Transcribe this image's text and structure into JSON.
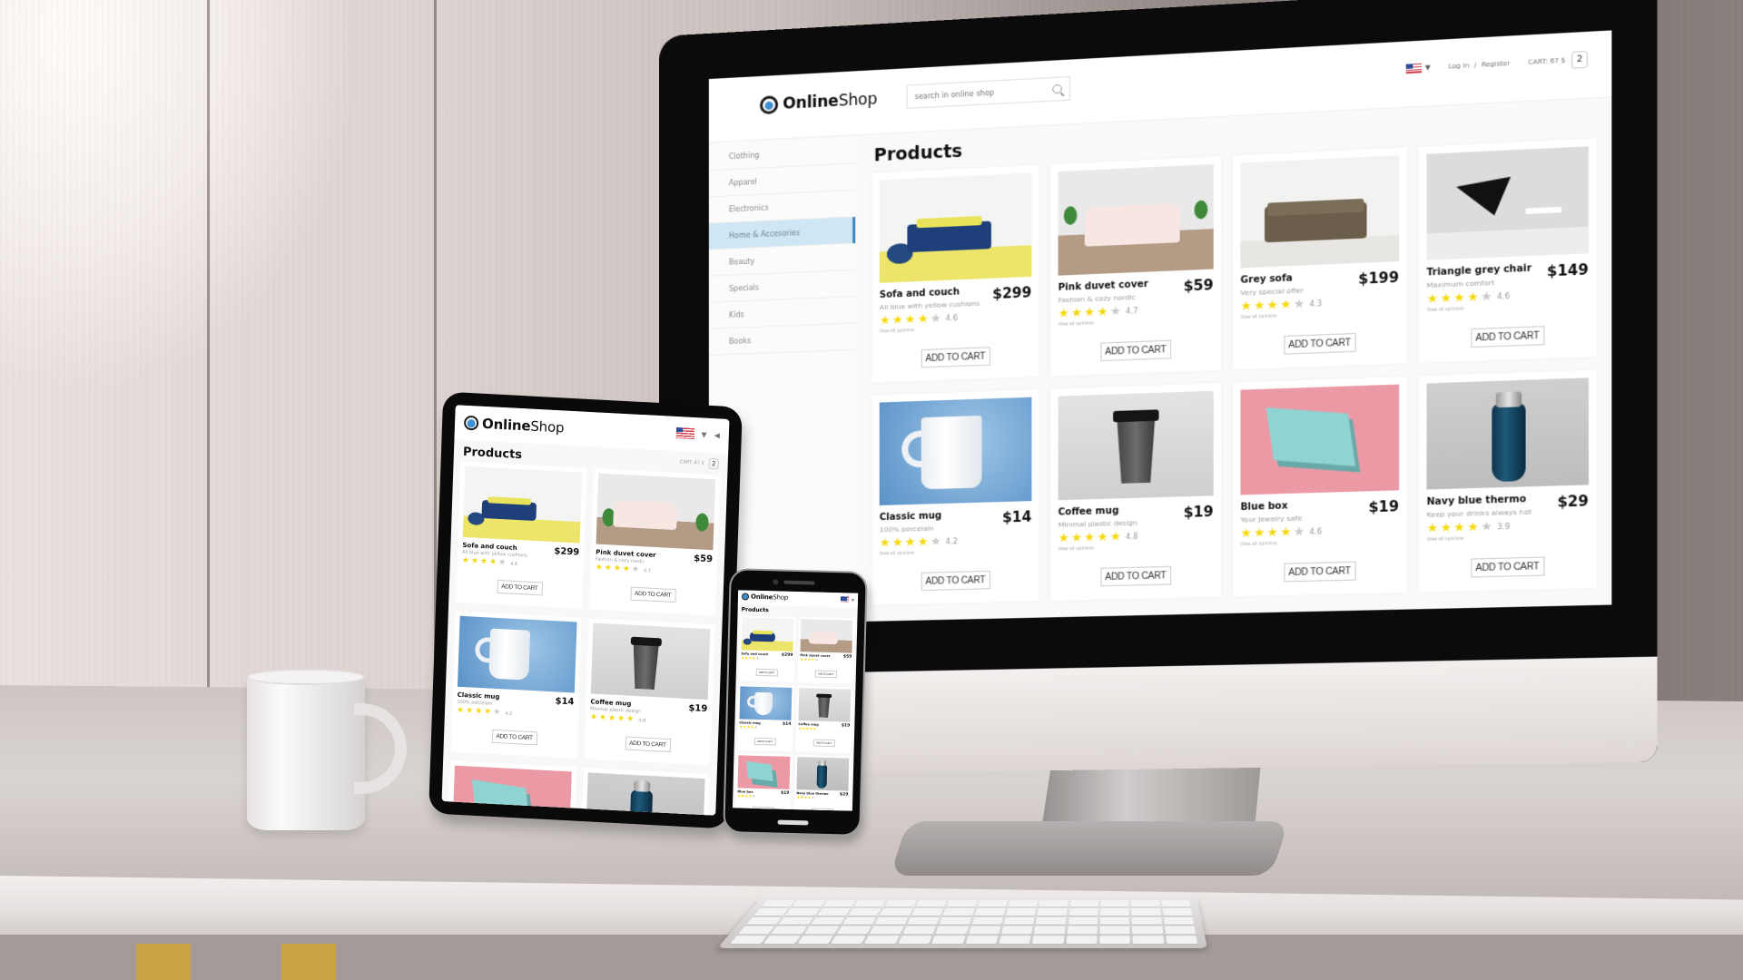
{
  "scene": {
    "description": "Responsive e-commerce mockup on desktop monitor, tablet and phone on a desk"
  },
  "brand": {
    "name_bold": "Online",
    "name_light": "Shop",
    "accent_color": "#3f87c2",
    "star_color": "#f5d90b"
  },
  "header": {
    "search_placeholder": "search in online shop",
    "language": "US",
    "login_label": "Log in",
    "separator": "/",
    "register_label": "Register",
    "cart_label": "CART: 67 $",
    "cart_count": "2"
  },
  "sidebar": {
    "items": [
      {
        "label": "Clothing",
        "active": false
      },
      {
        "label": "Apparel",
        "active": false
      },
      {
        "label": "Electronics",
        "active": false
      },
      {
        "label": "Home & Accesories",
        "active": true
      },
      {
        "label": "Beauty",
        "active": false
      },
      {
        "label": "Specials",
        "active": false
      },
      {
        "label": "Kids",
        "active": false
      },
      {
        "label": "Books",
        "active": false
      }
    ]
  },
  "main": {
    "title": "Products",
    "add_to_cart_label": "ADD TO CART",
    "view_opinions_label": "View all opinions",
    "products": [
      {
        "name": "Sofa and couch",
        "subtitle": "All blue with yellow cushions",
        "price": "$299",
        "rating": 4.6,
        "rating_text": "4.6",
        "stars_full": 4,
        "image": "sofa"
      },
      {
        "name": "Pink duvet cover",
        "subtitle": "Fashion & cozy nordic",
        "price": "$59",
        "rating": 4.7,
        "rating_text": "4.7",
        "stars_full": 4,
        "image": "bed"
      },
      {
        "name": "Grey sofa",
        "subtitle": "Very special offer",
        "price": "$199",
        "rating": 4.3,
        "rating_text": "4.3",
        "stars_full": 4,
        "image": "grey"
      },
      {
        "name": "Triangle grey chair",
        "subtitle": "Maximum comfort",
        "price": "$149",
        "rating": 4.6,
        "rating_text": "4.6",
        "stars_full": 4,
        "image": "chair"
      },
      {
        "name": "Classic mug",
        "subtitle": "100% porcelain",
        "price": "$14",
        "rating": 4.2,
        "rating_text": "4.2",
        "stars_full": 4,
        "image": "mug"
      },
      {
        "name": "Coffee mug",
        "subtitle": "Minimal plastic design",
        "price": "$19",
        "rating": 4.8,
        "rating_text": "4.8",
        "stars_full": 5,
        "image": "cup"
      },
      {
        "name": "Blue box",
        "subtitle": "Your jewelry safe",
        "price": "$19",
        "rating": 4.6,
        "rating_text": "4.6",
        "stars_full": 4,
        "image": "box"
      },
      {
        "name": "Navy blue thermo",
        "subtitle": "Keep your drinks always hot",
        "price": "$29",
        "rating": 3.9,
        "rating_text": "3.9",
        "stars_full": 4,
        "image": "thermo"
      }
    ]
  },
  "tablet": {
    "title": "Products",
    "cart_label": "CART: 67 $",
    "cart_count": "2",
    "visible_products": [
      0,
      1,
      4,
      5,
      6,
      7
    ]
  },
  "phone": {
    "title": "Products",
    "visible_products": [
      0,
      1,
      4,
      5,
      6,
      7
    ]
  }
}
